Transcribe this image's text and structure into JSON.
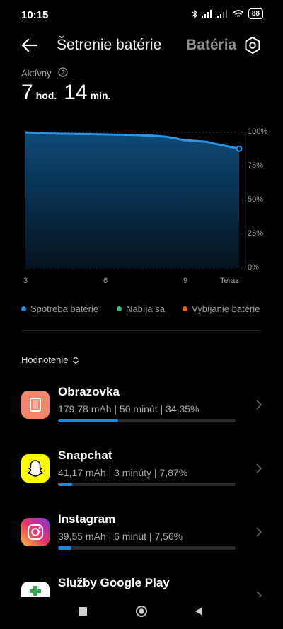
{
  "status_bar": {
    "time": "10:15",
    "battery": "88"
  },
  "header": {
    "title": "Šetrenie batérie",
    "tab": "Batéria"
  },
  "active": {
    "label": "Aktívny",
    "hours": "7",
    "hours_unit": "hod.",
    "minutes": "14",
    "minutes_unit": "min."
  },
  "chart_data": {
    "type": "area",
    "x_ticks": [
      "3",
      "6",
      "9",
      "Teraz"
    ],
    "y_ticks": [
      "100%",
      "75%",
      "50%",
      "25%",
      "0%"
    ],
    "ylim": [
      0,
      100
    ],
    "series": [
      {
        "name": "Spotreba batérie",
        "x": [
          0,
          0.1,
          0.2,
          0.3,
          0.4,
          0.5,
          0.55,
          0.6,
          0.66,
          0.7,
          0.74,
          0.8,
          0.85,
          0.9,
          0.95,
          1.0
        ],
        "values": [
          100,
          99.2,
          98.9,
          98.7,
          98.4,
          98.1,
          97.8,
          97.5,
          96.7,
          95.6,
          94.3,
          93.6,
          93.0,
          91.2,
          89.6,
          87.9
        ]
      }
    ]
  },
  "legend": [
    {
      "label": "Spotreba batérie",
      "color": "#1e90e8"
    },
    {
      "label": "Nabíja sa",
      "color": "#2ec27e"
    },
    {
      "label": "Vybíjanie batérie",
      "color": "#f05a28"
    }
  ],
  "sort_label": "Hodnotenie",
  "apps": [
    {
      "name": "Obrazovka",
      "detail": "179,78 mAh | 50 minút  | 34,35%",
      "share": 34.35,
      "icon": "screen-icon"
    },
    {
      "name": "Snapchat",
      "detail": "41,17 mAh | 3 minúty  | 7,87%",
      "share": 7.87,
      "icon": "snapchat-icon"
    },
    {
      "name": "Instagram",
      "detail": "39,55 mAh | 6 minút  | 7,56%",
      "share": 7.56,
      "icon": "instagram-icon"
    },
    {
      "name": "Služby Google Play",
      "detail": "",
      "share": 0,
      "icon": "google-play-services-icon"
    }
  ]
}
